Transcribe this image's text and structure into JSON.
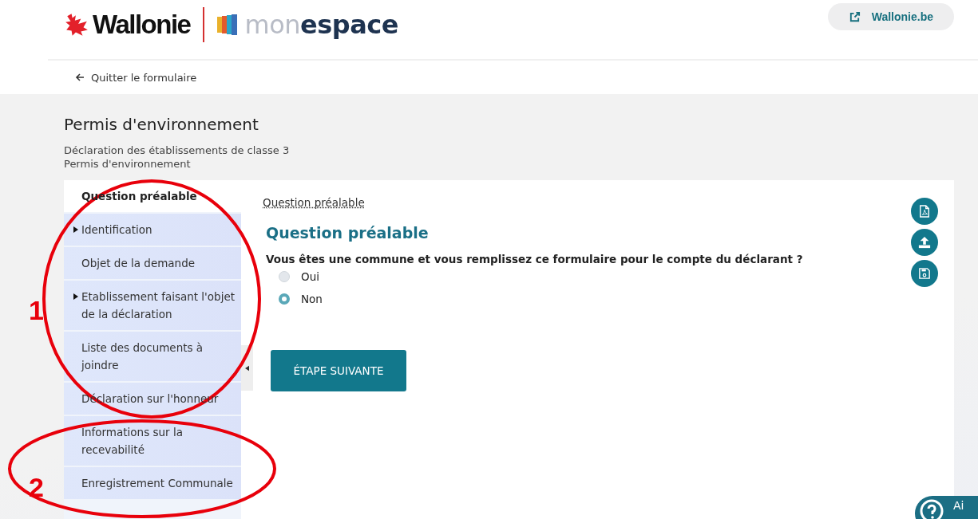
{
  "header": {
    "logo_text": "Wallonie",
    "brand_light": "mon",
    "brand_bold": "espace",
    "external_link": "Wallonie.be"
  },
  "back_link": "Quitter le formulaire",
  "form": {
    "title": "Permis d'environnement",
    "subtitle_lines": [
      "Déclaration des établissements de classe 3",
      "Permis d'environnement"
    ]
  },
  "sidebar": {
    "items": [
      {
        "label": "Question préalable",
        "selected": true,
        "expandable": false
      },
      {
        "label": "Identification",
        "selected": false,
        "expandable": true
      },
      {
        "label": "Objet de la demande",
        "selected": false,
        "expandable": false
      },
      {
        "label": "Etablissement faisant l'objet de la déclaration",
        "selected": false,
        "expandable": true
      },
      {
        "label": "Liste des documents à joindre",
        "selected": false,
        "expandable": false
      },
      {
        "label": "Déclaration sur l'honneur",
        "selected": false,
        "expandable": false
      },
      {
        "label": "Informations sur la recevabilité",
        "selected": false,
        "expandable": false
      },
      {
        "label": "Enregistrement Communale",
        "selected": false,
        "expandable": false
      }
    ]
  },
  "main": {
    "breadcrumb": "Question préalable",
    "heading": "Question préalable",
    "question": "Vous êtes une commune et vous remplissez ce formulaire pour le compte du déclarant ?",
    "options": [
      {
        "label": "Oui",
        "selected": false
      },
      {
        "label": "Non",
        "selected": true
      }
    ],
    "next_button": "ÉTAPE SUIVANTE"
  },
  "help_button": "Ai",
  "annotations": [
    {
      "number": "1"
    },
    {
      "number": "2"
    }
  ]
}
